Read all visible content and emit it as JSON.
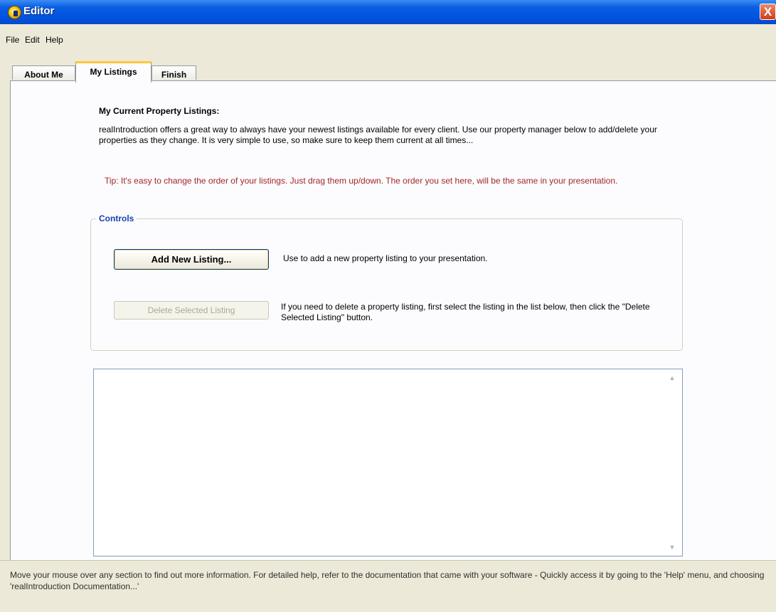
{
  "window": {
    "title": "Editor",
    "close_glyph": "X",
    "icon": "app-globe-icon"
  },
  "menu": [
    "File",
    "Edit",
    "Help"
  ],
  "tabs": [
    {
      "label": "About Me",
      "active": false
    },
    {
      "label": "My Listings",
      "active": true
    },
    {
      "label": "Finish",
      "active": false
    }
  ],
  "listings_page": {
    "heading": "My Current Property Listings:",
    "intro": "realIntroduction offers a great way to always have your newest listings available for every client. Use our property manager below to add/delete your properties as they change. It is very simple to use, so make sure to keep them current at all times...",
    "tip": "Tip: It's easy to change the order of your listings. Just drag them up/down. The order you set here, will be the same in your presentation.",
    "controls_label": "Controls",
    "add_button": "Add New Listing...",
    "add_description": "Use to add a new property listing to your presentation.",
    "delete_button": "Delete Selected Listing",
    "delete_enabled": false,
    "delete_description": "If you need to delete a property listing, first select the listing in the list below, then click the \"Delete Selected Listing\" button.",
    "scroll_up_glyph": "▲",
    "scroll_down_glyph": "▼"
  },
  "status_text": "Move your mouse over any section to find out more information. For detailed help, refer to the documentation that came with your software - Quickly access it by going to the 'Help' menu, and choosing 'realIntroduction Documentation...'",
  "colors": {
    "titlebar": "#0053e1",
    "tip": "#a3262a",
    "group_label": "#1840b0",
    "active_tab_accent": "#ffc83c"
  }
}
